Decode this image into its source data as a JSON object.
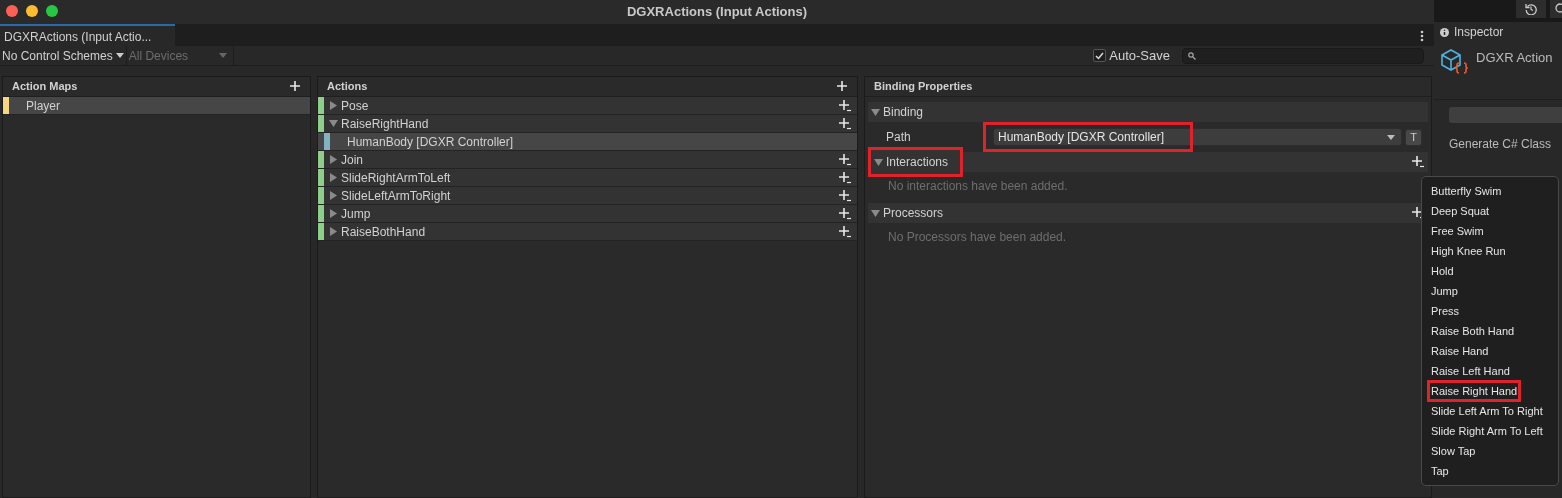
{
  "window": {
    "title": "DGXRActions (Input Actions)"
  },
  "tab": {
    "label": "DGXRActions (Input Actio...",
    "selected": true
  },
  "toolbar": {
    "control_scheme": "No Control Schemes",
    "devices": {
      "label": "All Devices",
      "disabled": true
    },
    "auto_save": {
      "label": "Auto-Save",
      "checked": true
    }
  },
  "action_maps": {
    "title": "Action Maps",
    "items": [
      {
        "label": "Player",
        "selected": true
      }
    ]
  },
  "actions": {
    "title": "Actions",
    "items": [
      {
        "label": "Pose",
        "expanded": false
      },
      {
        "label": "RaiseRightHand",
        "expanded": true,
        "children": [
          {
            "label": "HumanBody [DGXR Controller]",
            "selected": true
          }
        ]
      },
      {
        "label": "Join",
        "expanded": false
      },
      {
        "label": "SlideRightArmToLeft",
        "expanded": false
      },
      {
        "label": "SlideLeftArmToRight",
        "expanded": false
      },
      {
        "label": "Jump",
        "expanded": false
      },
      {
        "label": "RaiseBothHand",
        "expanded": false
      }
    ]
  },
  "binding_properties": {
    "title": "Binding Properties",
    "sections": [
      {
        "kind": "fields",
        "title": "Binding",
        "expanded": true,
        "highlighted": false,
        "fields": [
          {
            "label": "Path",
            "value": "HumanBody [DGXR Controller]",
            "highlighted": true,
            "button": "T"
          }
        ]
      },
      {
        "kind": "list",
        "title": "Interactions",
        "expanded": true,
        "highlighted": true,
        "empty_text": "No interactions have been added."
      },
      {
        "kind": "list",
        "title": "Processors",
        "expanded": true,
        "highlighted": false,
        "empty_text": "No Processors have been added."
      }
    ]
  },
  "inspector": {
    "tab": "Inspector",
    "asset_name": "DGXR Action",
    "option": "Generate C# Class"
  },
  "dropdown_menu": {
    "items": [
      {
        "label": "Butterfly Swim",
        "highlighted": false
      },
      {
        "label": "Deep Squat",
        "highlighted": false
      },
      {
        "label": "Free Swim",
        "highlighted": false
      },
      {
        "label": "High Knee Run",
        "highlighted": false
      },
      {
        "label": "Hold",
        "highlighted": false
      },
      {
        "label": "Jump",
        "highlighted": false
      },
      {
        "label": "Press",
        "highlighted": false
      },
      {
        "label": "Raise Both Hand",
        "highlighted": false
      },
      {
        "label": "Raise Hand",
        "highlighted": false
      },
      {
        "label": "Raise Left Hand",
        "highlighted": false
      },
      {
        "label": "Raise Right Hand",
        "highlighted": true
      },
      {
        "label": "Slide Left Arm To Right",
        "highlighted": false
      },
      {
        "label": "Slide Right Arm To Left",
        "highlighted": false
      },
      {
        "label": "Slow Tap",
        "highlighted": false
      },
      {
        "label": "Tap",
        "highlighted": false
      }
    ]
  }
}
